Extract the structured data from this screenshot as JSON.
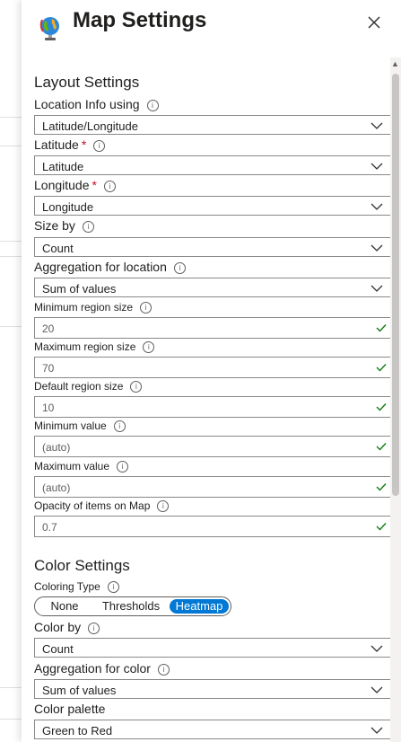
{
  "title": "Map Settings",
  "layout_section": "Layout Settings",
  "color_section": "Color Settings",
  "fields": {
    "location_info": {
      "label": "Location Info using",
      "value": "Latitude/Longitude"
    },
    "latitude": {
      "label": "Latitude",
      "required": "*",
      "value": "Latitude"
    },
    "longitude": {
      "label": "Longitude",
      "required": "*",
      "value": "Longitude"
    },
    "size_by": {
      "label": "Size by",
      "value": "Count"
    },
    "aggregation_location": {
      "label": "Aggregation for location",
      "value": "Sum of values"
    },
    "min_region": {
      "label": "Minimum region size",
      "value": "20"
    },
    "max_region": {
      "label": "Maximum region size",
      "value": "70"
    },
    "default_region": {
      "label": "Default region size",
      "value": "10"
    },
    "min_value": {
      "label": "Minimum value",
      "value": "(auto)"
    },
    "max_value": {
      "label": "Maximum value",
      "value": "(auto)"
    },
    "opacity": {
      "label": "Opacity of items on Map",
      "value": "0.7"
    },
    "coloring_type": {
      "label": "Coloring Type",
      "options": [
        "None",
        "Thresholds",
        "Heatmap"
      ],
      "selected": "Heatmap"
    },
    "color_by": {
      "label": "Color by",
      "value": "Count"
    },
    "aggregation_color": {
      "label": "Aggregation for color",
      "value": "Sum of values"
    },
    "color_palette": {
      "label": "Color palette",
      "value": "Green to Red"
    }
  },
  "colors": {
    "accent": "#0078d4",
    "check": "#107c10",
    "required": "#c50f1f"
  }
}
